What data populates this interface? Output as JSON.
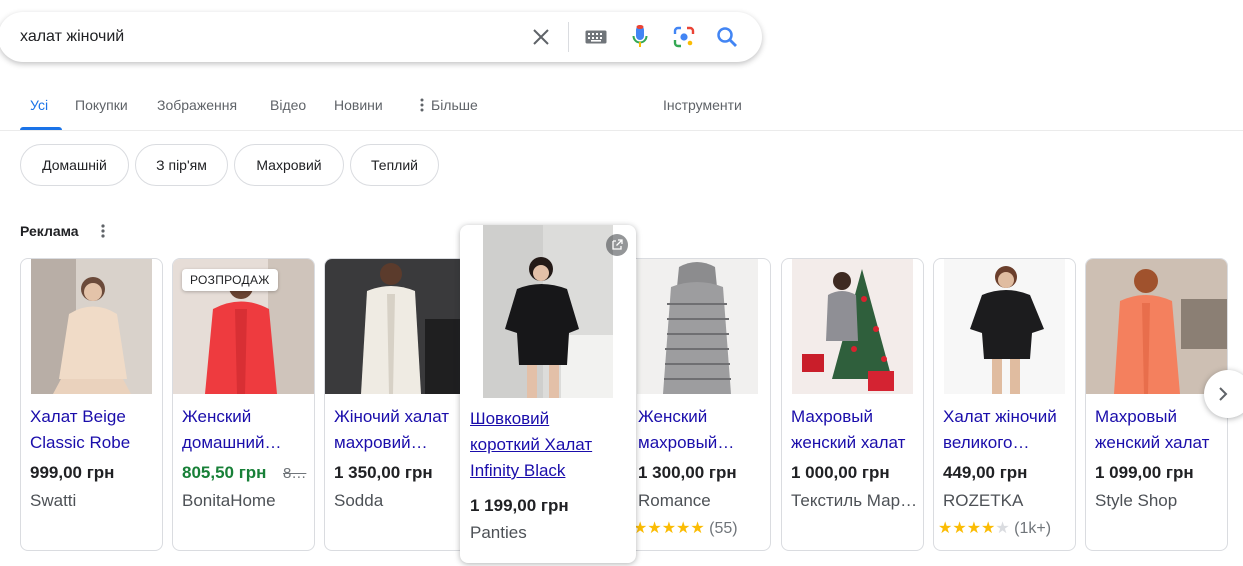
{
  "search": {
    "query": "халат жіночий"
  },
  "tabs": [
    {
      "label": "Усі"
    },
    {
      "label": "Покупки"
    },
    {
      "label": "Зображення"
    },
    {
      "label": "Відео"
    },
    {
      "label": "Новини"
    },
    {
      "label": "Більше"
    }
  ],
  "tools_label": "Інструменти",
  "chips": [
    {
      "label": "Домашній"
    },
    {
      "label": "З пір'ям"
    },
    {
      "label": "Махровий"
    },
    {
      "label": "Теплий"
    }
  ],
  "ads": {
    "title": "Реклама",
    "products": [
      {
        "title": "Халат Beige Classic Robe",
        "price": "999,00 грн",
        "store": "Swatti"
      },
      {
        "title": "Женский домашний халат",
        "price": "805,50 грн",
        "old_price": "8…",
        "store": "BonitaHome",
        "badge": "РОЗПРОДАЖ"
      },
      {
        "title": "Жіночий халат махровий теплий",
        "price": "1 350,00 грн",
        "store": "Sodda"
      },
      {
        "title": "Шовковий короткий Халат Infinity Black",
        "price": "1 199,00 грн",
        "store": "Panties"
      },
      {
        "title": "Женский махровый халат",
        "price": "1 300,00 грн",
        "store": "Romance",
        "rating_count": "(55)",
        "rating": 5
      },
      {
        "title": "Махровый женский халат",
        "price": "1 000,00 грн",
        "store": "Текстиль Маркет"
      },
      {
        "title": "Халат жіночий великого розміру",
        "price": "449,00 грн",
        "store": "ROZETKA",
        "rating_count": "(1k+)",
        "rating": 4
      },
      {
        "title": "Махровый женский халат",
        "price": "1 099,00 грн",
        "store": "Style Shop"
      }
    ]
  },
  "colors": {
    "link": "#1a0dab",
    "accent": "#1a73e8",
    "sale_price": "#188038",
    "star": "#fbbc04"
  }
}
